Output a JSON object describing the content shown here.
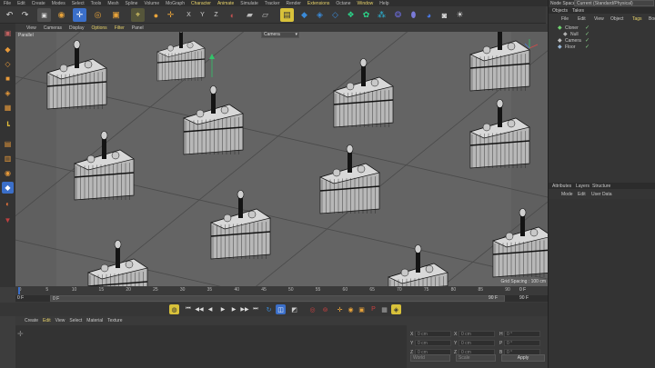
{
  "menubar": {
    "items": [
      {
        "label": "File",
        "hl": false
      },
      {
        "label": "Edit",
        "hl": false
      },
      {
        "label": "Create",
        "hl": false
      },
      {
        "label": "Modes",
        "hl": false
      },
      {
        "label": "Select",
        "hl": false
      },
      {
        "label": "Tools",
        "hl": false
      },
      {
        "label": "Mesh",
        "hl": false
      },
      {
        "label": "Spline",
        "hl": false
      },
      {
        "label": "Volume",
        "hl": false
      },
      {
        "label": "MoGraph",
        "hl": false
      },
      {
        "label": "Character",
        "hl": true
      },
      {
        "label": "Animate",
        "hl": true
      },
      {
        "label": "Simulate",
        "hl": false
      },
      {
        "label": "Tracker",
        "hl": false
      },
      {
        "label": "Render",
        "hl": false
      },
      {
        "label": "Extensions",
        "hl": true
      },
      {
        "label": "Octane",
        "hl": false
      },
      {
        "label": "Window",
        "hl": true
      },
      {
        "label": "Help",
        "hl": false
      }
    ]
  },
  "nodespace": {
    "label": "Node Space:",
    "value": "Current (Standard/Physical)"
  },
  "viewport": {
    "menu": [
      {
        "label": "View",
        "hl": false
      },
      {
        "label": "Cameras",
        "hl": false
      },
      {
        "label": "Display",
        "hl": false
      },
      {
        "label": "Options",
        "hl": true
      },
      {
        "label": "Filter",
        "hl": true
      },
      {
        "label": "Panel",
        "hl": false
      }
    ],
    "projection": "Parallel",
    "camera_select": "Camera",
    "grid_spacing": "Grid Spacing : 100 cm"
  },
  "timeline": {
    "ticks": [
      "0",
      "5",
      "10",
      "15",
      "20",
      "25",
      "30",
      "35",
      "40",
      "45",
      "50",
      "55",
      "60",
      "65",
      "70",
      "75",
      "80",
      "85",
      "90"
    ],
    "frame_left": "0 F",
    "frame_field": "0 F",
    "frame_end": "90 F",
    "frame_right": "0 F",
    "frame_right2": "90 F",
    "frame_right3": "90 F"
  },
  "materials": {
    "menu": [
      {
        "label": "Create",
        "hl": false
      },
      {
        "label": "Edit",
        "hl": true
      },
      {
        "label": "View",
        "hl": false
      },
      {
        "label": "Select",
        "hl": false
      },
      {
        "label": "Material",
        "hl": false
      },
      {
        "label": "Texture",
        "hl": false
      }
    ]
  },
  "coords": {
    "rows": [
      {
        "a": "X",
        "av": "0 cm",
        "b": "X",
        "bv": "0 cm",
        "c": "H",
        "cv": "0 °"
      },
      {
        "a": "Y",
        "av": "0 cm",
        "b": "Y",
        "bv": "0 cm",
        "c": "P",
        "cv": "0 °"
      },
      {
        "a": "Z",
        "av": "0 cm",
        "b": "Z",
        "bv": "0 cm",
        "c": "B",
        "cv": "0 °"
      }
    ],
    "mode1": "World",
    "mode2": "Scale",
    "apply": "Apply"
  },
  "objects_panel": {
    "tabs": [
      "Objects",
      "Takes"
    ],
    "menu": [
      "File",
      "Edit",
      "View",
      "Object",
      "Tags",
      "Bookmarks"
    ],
    "items": [
      {
        "label": "Cloner",
        "indent": 0,
        "icon_color": "#6fd16f"
      },
      {
        "label": "Null",
        "indent": 1,
        "icon_color": "#b0b0b0"
      },
      {
        "label": "Camera",
        "indent": 0,
        "icon_color": "#c0c0c0"
      },
      {
        "label": "Floor",
        "indent": 0,
        "icon_color": "#9ab8d8"
      }
    ]
  },
  "attributes_panel": {
    "tabs": [
      "Attributes",
      "Layers",
      "Structure"
    ],
    "menu": [
      "Mode",
      "Edit",
      "User Data"
    ]
  },
  "colors": {
    "accent": "#e8d36a",
    "toolbar_yellow": "#d8c13a",
    "toolbar_blue": "#3a6ad8",
    "toolbar_cyan": "#2bb5a8"
  }
}
